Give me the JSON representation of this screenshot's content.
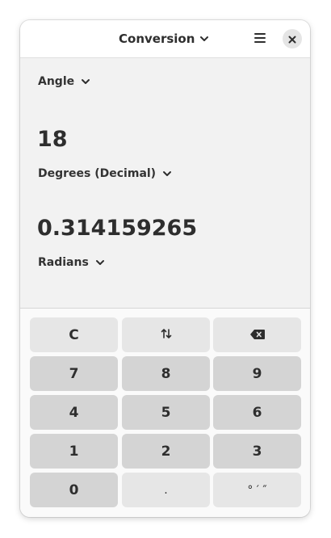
{
  "header": {
    "title": "Conversion"
  },
  "converter": {
    "category": "Angle",
    "from_value": "18",
    "from_unit": "Degrees (Decimal)",
    "to_value": "0.314159265",
    "to_unit": "Radians"
  },
  "keypad": {
    "clear": "C",
    "swap_icon": "swap-vertical-icon",
    "backspace_icon": "backspace-icon",
    "keys": {
      "k7": "7",
      "k8": "8",
      "k9": "9",
      "k4": "4",
      "k5": "5",
      "k6": "6",
      "k1": "1",
      "k2": "2",
      "k3": "3",
      "k0": "0",
      "dot": ".",
      "dms": "° ′ ″"
    }
  },
  "icons": {
    "menu": "hamburger-menu-icon",
    "close": "close-icon",
    "dropdown": "chevron-down-icon"
  },
  "colors": {
    "window_bg": "#f2f2f2",
    "header_bg": "#ffffff",
    "key_light": "#e6e6e6",
    "key_dark": "#d4d4d4",
    "text": "#2e2e2e"
  }
}
